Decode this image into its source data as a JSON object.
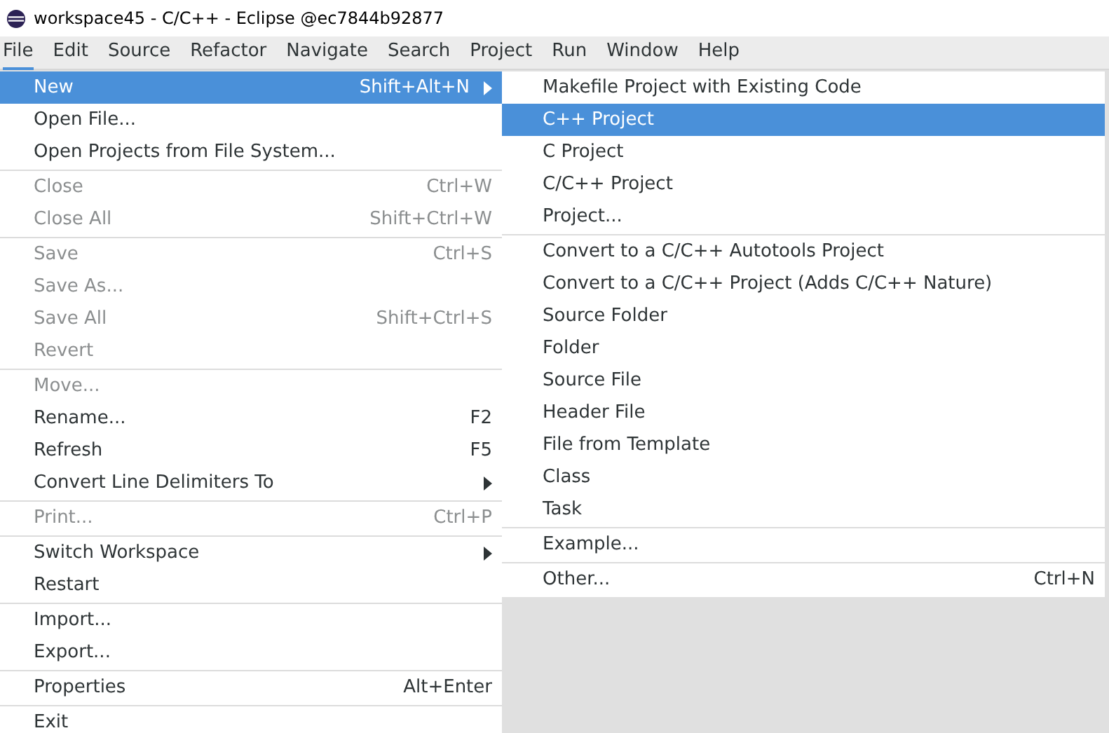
{
  "window": {
    "title": "workspace45 - C/C++ - Eclipse @ec7844b92877"
  },
  "menubar": [
    {
      "label": "File",
      "selected": true
    },
    {
      "label": "Edit",
      "selected": false
    },
    {
      "label": "Source",
      "selected": false
    },
    {
      "label": "Refactor",
      "selected": false
    },
    {
      "label": "Navigate",
      "selected": false
    },
    {
      "label": "Search",
      "selected": false
    },
    {
      "label": "Project",
      "selected": false
    },
    {
      "label": "Run",
      "selected": false
    },
    {
      "label": "Window",
      "selected": false
    },
    {
      "label": "Help",
      "selected": false
    }
  ],
  "file_menu": [
    {
      "kind": "item",
      "label": "New",
      "shortcut": "Shift+Alt+N",
      "submenu": true,
      "selected": true,
      "disabled": false
    },
    {
      "kind": "item",
      "label": "Open File...",
      "submenu": false,
      "selected": false,
      "disabled": false
    },
    {
      "kind": "item",
      "label": "Open Projects from File System...",
      "submenu": false,
      "selected": false,
      "disabled": false
    },
    {
      "kind": "separator"
    },
    {
      "kind": "item",
      "label": "Close",
      "shortcut": "Ctrl+W",
      "submenu": false,
      "selected": false,
      "disabled": true
    },
    {
      "kind": "item",
      "label": "Close All",
      "shortcut": "Shift+Ctrl+W",
      "submenu": false,
      "selected": false,
      "disabled": true
    },
    {
      "kind": "separator"
    },
    {
      "kind": "item",
      "label": "Save",
      "shortcut": "Ctrl+S",
      "submenu": false,
      "selected": false,
      "disabled": true
    },
    {
      "kind": "item",
      "label": "Save As...",
      "submenu": false,
      "selected": false,
      "disabled": true
    },
    {
      "kind": "item",
      "label": "Save All",
      "shortcut": "Shift+Ctrl+S",
      "submenu": false,
      "selected": false,
      "disabled": true
    },
    {
      "kind": "item",
      "label": "Revert",
      "submenu": false,
      "selected": false,
      "disabled": true
    },
    {
      "kind": "separator"
    },
    {
      "kind": "item",
      "label": "Move...",
      "submenu": false,
      "selected": false,
      "disabled": true
    },
    {
      "kind": "item",
      "label": "Rename...",
      "shortcut": "F2",
      "submenu": false,
      "selected": false,
      "disabled": false
    },
    {
      "kind": "item",
      "label": "Refresh",
      "shortcut": "F5",
      "submenu": false,
      "selected": false,
      "disabled": false
    },
    {
      "kind": "item",
      "label": "Convert Line Delimiters To",
      "submenu": true,
      "selected": false,
      "disabled": false
    },
    {
      "kind": "separator"
    },
    {
      "kind": "item",
      "label": "Print...",
      "shortcut": "Ctrl+P",
      "submenu": false,
      "selected": false,
      "disabled": true
    },
    {
      "kind": "separator"
    },
    {
      "kind": "item",
      "label": "Switch Workspace",
      "submenu": true,
      "selected": false,
      "disabled": false
    },
    {
      "kind": "item",
      "label": "Restart",
      "submenu": false,
      "selected": false,
      "disabled": false
    },
    {
      "kind": "separator"
    },
    {
      "kind": "item",
      "label": "Import...",
      "submenu": false,
      "selected": false,
      "disabled": false
    },
    {
      "kind": "item",
      "label": "Export...",
      "submenu": false,
      "selected": false,
      "disabled": false
    },
    {
      "kind": "separator"
    },
    {
      "kind": "item",
      "label": "Properties",
      "shortcut": "Alt+Enter",
      "submenu": false,
      "selected": false,
      "disabled": false
    },
    {
      "kind": "separator"
    },
    {
      "kind": "item",
      "label": "Exit",
      "submenu": false,
      "selected": false,
      "disabled": false
    }
  ],
  "new_submenu": [
    {
      "kind": "item",
      "label": "Makefile Project with Existing Code",
      "selected": false
    },
    {
      "kind": "item",
      "label": "C++ Project",
      "selected": true
    },
    {
      "kind": "item",
      "label": "C Project",
      "selected": false
    },
    {
      "kind": "item",
      "label": "C/C++ Project",
      "selected": false
    },
    {
      "kind": "item",
      "label": "Project...",
      "selected": false
    },
    {
      "kind": "separator"
    },
    {
      "kind": "item",
      "label": "Convert to a C/C++ Autotools Project",
      "selected": false
    },
    {
      "kind": "item",
      "label": "Convert to a C/C++ Project (Adds C/C++ Nature)",
      "selected": false
    },
    {
      "kind": "item",
      "label": "Source Folder",
      "selected": false
    },
    {
      "kind": "item",
      "label": "Folder",
      "selected": false
    },
    {
      "kind": "item",
      "label": "Source File",
      "selected": false
    },
    {
      "kind": "item",
      "label": "Header File",
      "selected": false
    },
    {
      "kind": "item",
      "label": "File from Template",
      "selected": false
    },
    {
      "kind": "item",
      "label": "Class",
      "selected": false
    },
    {
      "kind": "item",
      "label": "Task",
      "selected": false
    },
    {
      "kind": "separator"
    },
    {
      "kind": "item",
      "label": "Example...",
      "selected": false
    },
    {
      "kind": "separator"
    },
    {
      "kind": "item",
      "label": "Other...",
      "shortcut": "Ctrl+N",
      "selected": false
    }
  ]
}
